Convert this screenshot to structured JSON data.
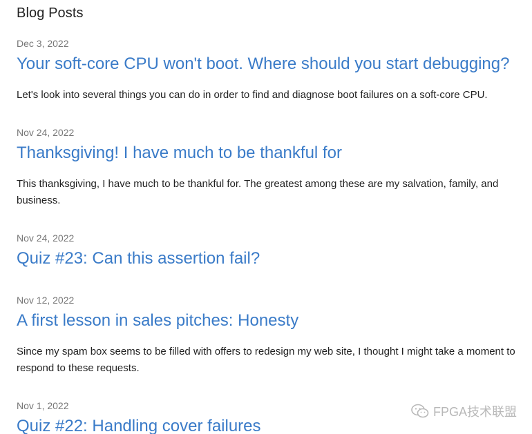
{
  "page": {
    "heading": "Blog Posts"
  },
  "posts": [
    {
      "date": "Dec 3, 2022",
      "title": "Your soft-core CPU won't boot. Where should you start debugging?",
      "excerpt": "Let's look into several things you can do in order to find and diagnose boot failures on a soft-core CPU."
    },
    {
      "date": "Nov 24, 2022",
      "title": "Thanksgiving! I have much to be thankful for",
      "excerpt": "This thanksgiving, I have much to be thankful for. The greatest among these are my salvation, family, and business."
    },
    {
      "date": "Nov 24, 2022",
      "title": "Quiz #23: Can this assertion fail?",
      "excerpt": ""
    },
    {
      "date": "Nov 12, 2022",
      "title": "A first lesson in sales pitches: Honesty",
      "excerpt": "Since my spam box seems to be filled with offers to redesign my web site, I thought I might take a moment to respond to these requests."
    },
    {
      "date": "Nov 1, 2022",
      "title": "Quiz #22: Handling cover failures",
      "excerpt": ""
    }
  ],
  "watermark": {
    "text": "FPGA技术联盟",
    "icon": "wechat-icon"
  },
  "colors": {
    "link": "#3a7bc8",
    "date": "#777777",
    "text": "#222222"
  }
}
